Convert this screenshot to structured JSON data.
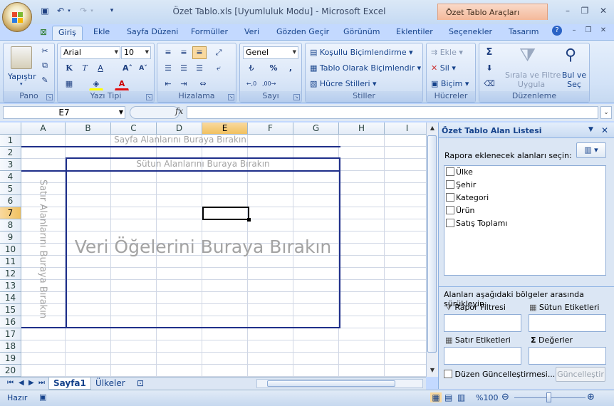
{
  "window": {
    "title": "Özet Tablo.xls  [Uyumluluk Modu] - Microsoft Excel",
    "context_tab": "Özet Tablo Araçları"
  },
  "tabs": [
    "Giriş",
    "Ekle",
    "Sayfa Düzeni",
    "Formüller",
    "Veri",
    "Gözden Geçir",
    "Görünüm",
    "Eklentiler",
    "Seçenekler",
    "Tasarım"
  ],
  "ribbon": {
    "pano": {
      "label": "Pano",
      "paste": "Yapıştır"
    },
    "font": {
      "label": "Yazı Tipi",
      "name": "Arial",
      "size": "10"
    },
    "align": {
      "label": "Hizalama"
    },
    "number": {
      "label": "Sayı",
      "format": "Genel",
      "percent": "%",
      "comma": ","
    },
    "styles": {
      "label": "Stiller",
      "cond": "Koşullu Biçimlendirme",
      "table": "Tablo Olarak Biçimlendir",
      "cell": "Hücre Stilleri"
    },
    "cells": {
      "label": "Hücreler",
      "insert": "Ekle",
      "delete": "Sil",
      "format": "Biçim"
    },
    "edit": {
      "label": "Düzenleme",
      "sort1": "Sırala ve Filtre",
      "sort2": "Uygula",
      "find1": "Bul ve",
      "find2": "Seç"
    }
  },
  "formula_bar": {
    "name_box": "E7",
    "fx": "fx"
  },
  "columns": [
    "A",
    "B",
    "C",
    "D",
    "E",
    "F",
    "G",
    "H",
    "I"
  ],
  "rows": [
    "1",
    "2",
    "3",
    "4",
    "5",
    "6",
    "7",
    "8",
    "9",
    "10",
    "11",
    "12",
    "13",
    "14",
    "15",
    "16",
    "17",
    "18",
    "19",
    "20"
  ],
  "pivot": {
    "page": "Sayfa Alanlarını Buraya Bırakın",
    "col": "Sütun Alanlarını Buraya Bırakın",
    "row": "Satır Alanlarını Buraya Bırakın",
    "data": "Veri Öğelerini Buraya Bırakın"
  },
  "sheets": [
    "Sayfa1",
    "Ülkeler"
  ],
  "field_list": {
    "title": "Özet Tablo Alan Listesi",
    "choose": "Rapora eklenecek alanları seçin:",
    "fields": [
      "Ülke",
      "Şehir",
      "Kategori",
      "Ürün",
      "Satış Toplamı"
    ],
    "drag": "Alanları aşağıdaki bölgeler arasında sürükleyin:",
    "report_filter": "Rapor Filtresi",
    "col_labels": "Sütun Etiketleri",
    "row_labels": "Satır Etiketleri",
    "values": "Değerler",
    "defer": "Düzen Güncelleştirmesi...",
    "update": "Güncelleştir"
  },
  "status": {
    "ready": "Hazır",
    "zoom": "%100"
  }
}
